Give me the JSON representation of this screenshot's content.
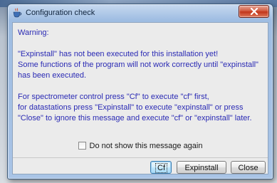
{
  "window": {
    "title": "Configuration check",
    "close_label": "Close window"
  },
  "message": {
    "heading": "Warning:",
    "para1": [
      "\"Expinstall\" has not been executed for this installation yet!",
      "Some functions of the program will not work correctly until \"expinstall\"",
      "has been executed."
    ],
    "para2": [
      "For spectrometer control press \"Cf\" to execute \"cf\" first,",
      "for datastations press \"Expinstall\" to execute \"expinstall\" or press",
      "\"Close\" to ignore this message and execute \"cf\" or \"expinstall\" later."
    ]
  },
  "checkbox": {
    "label": "Do not show this message again",
    "checked": false
  },
  "buttons": {
    "cf": "Cf",
    "expinstall": "Expinstall",
    "close": "Close"
  },
  "colors": {
    "message_text": "#2a2ab4",
    "title_bar": "#a9c4e6",
    "close_button": "#c2351a"
  },
  "icons": {
    "app": "java-coffee-cup-icon",
    "close": "close-x-icon"
  }
}
